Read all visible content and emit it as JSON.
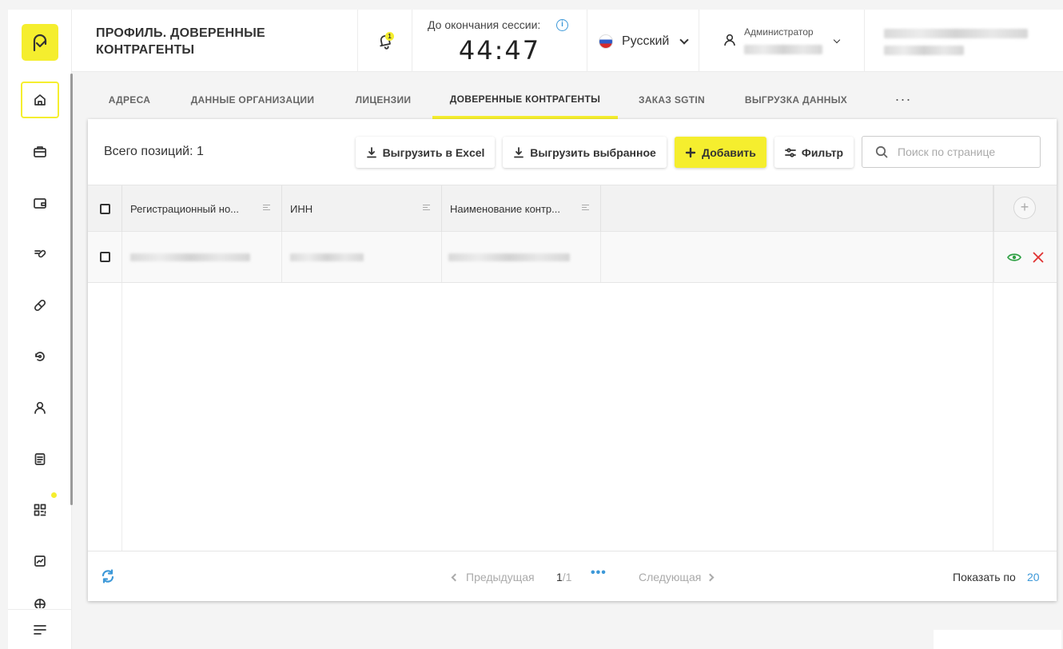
{
  "sidebar": {
    "items": [
      {
        "icon": "home-icon",
        "active": true
      },
      {
        "icon": "briefcase-icon"
      },
      {
        "icon": "wallet-icon"
      },
      {
        "icon": "pills-icon"
      },
      {
        "icon": "capsule-icon"
      },
      {
        "icon": "circular-arrow-icon"
      },
      {
        "icon": "user-icon"
      },
      {
        "icon": "document-list-icon"
      },
      {
        "icon": "qr-code-icon",
        "badge": true
      },
      {
        "icon": "chart-box-icon"
      },
      {
        "icon": "globe-icon"
      }
    ],
    "menu_icon": "hamburger-icon"
  },
  "header": {
    "title": "Профиль. Доверенные контрагенты",
    "notifications_count": "1",
    "session_label": "До окончания сессии:",
    "session_time": "44:47",
    "language": "Русский",
    "user_role": "Администратор"
  },
  "tabs": [
    {
      "label": "Адреса"
    },
    {
      "label": "Данные организации"
    },
    {
      "label": "Лицензии"
    },
    {
      "label": "Доверенные контрагенты",
      "active": true
    },
    {
      "label": "Заказ SGTIN"
    },
    {
      "label": "Выгрузка данных"
    }
  ],
  "tabs_more": "···",
  "toolbar": {
    "total_label": "Всего позиций: 1",
    "export_excel": "Выгрузить в Excel",
    "export_selected": "Выгрузить выбранное",
    "add": "Добавить",
    "filter": "Фильтр",
    "search_placeholder": "Поиск по странице"
  },
  "table": {
    "columns": [
      "Регистрационный но...",
      "ИНН",
      "Наименование контр..."
    ],
    "add_column": "+"
  },
  "pagination": {
    "prev": "Предыдущая",
    "current": "1",
    "total": "/1",
    "dots": "•••",
    "next": "Следующая",
    "page_size_label": "Показать по",
    "page_size": "20"
  },
  "colors": {
    "accent": "#f5ee2e",
    "link": "#3c98d8",
    "view": "#2ea043",
    "delete": "#e03131"
  }
}
